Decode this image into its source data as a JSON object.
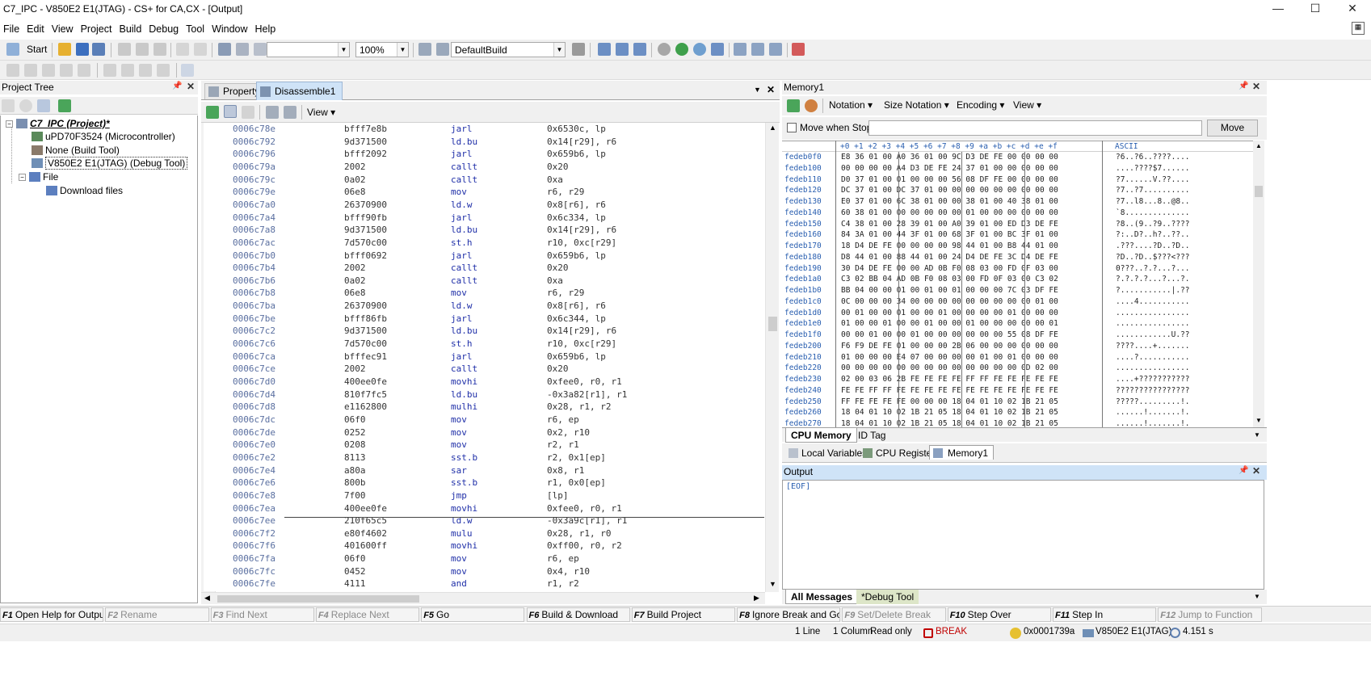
{
  "window": {
    "title": "C7_IPC - V850E2 E1(JTAG) - CS+ for CA,CX - [Output]",
    "minimize": "—",
    "maximize": "☐",
    "close": "✕"
  },
  "menu": [
    "File",
    "Edit",
    "View",
    "Project",
    "Build",
    "Debug",
    "Tool",
    "Window",
    "Help"
  ],
  "toolbar": {
    "start_label": "Start",
    "zoom": "100%",
    "build_config": "DefaultBuild",
    "search_value": ""
  },
  "project_tree": {
    "title": "Project Tree",
    "items": [
      {
        "label": "C7_IPC (Project)*",
        "level": 0
      },
      {
        "label": "uPD70F3524 (Microcontroller)",
        "level": 1
      },
      {
        "label": "None (Build Tool)",
        "level": 1
      },
      {
        "label": "V850E2 E1(JTAG) (Debug Tool)",
        "level": 1
      },
      {
        "label": "File",
        "level": 1
      },
      {
        "label": "Download files",
        "level": 2
      }
    ]
  },
  "center": {
    "tabs": [
      "Property",
      "Disassemble1"
    ],
    "active_tab": "Disassemble1",
    "view_label": "View ▾"
  },
  "disassembly": [
    [
      "0006c78e",
      "bfff7e8b",
      "jarl",
      "0x6530c, lp"
    ],
    [
      "0006c792",
      "9d371500",
      "ld.bu",
      "0x14[r29], r6"
    ],
    [
      "0006c796",
      "bfff2092",
      "jarl",
      "0x659b6, lp"
    ],
    [
      "0006c79a",
      "2002",
      "callt",
      "0x20"
    ],
    [
      "0006c79c",
      "0a02",
      "callt",
      "0xa"
    ],
    [
      "0006c79e",
      "06e8",
      "mov",
      "r6, r29"
    ],
    [
      "0006c7a0",
      "26370900",
      "ld.w",
      "0x8[r6], r6"
    ],
    [
      "0006c7a4",
      "bfff90fb",
      "jarl",
      "0x6c334, lp"
    ],
    [
      "0006c7a8",
      "9d371500",
      "ld.bu",
      "0x14[r29], r6"
    ],
    [
      "0006c7ac",
      "7d570c00",
      "st.h",
      "r10, 0xc[r29]"
    ],
    [
      "0006c7b0",
      "bfff0692",
      "jarl",
      "0x659b6, lp"
    ],
    [
      "0006c7b4",
      "2002",
      "callt",
      "0x20"
    ],
    [
      "0006c7b6",
      "0a02",
      "callt",
      "0xa"
    ],
    [
      "0006c7b8",
      "06e8",
      "mov",
      "r6, r29"
    ],
    [
      "0006c7ba",
      "26370900",
      "ld.w",
      "0x8[r6], r6"
    ],
    [
      "0006c7be",
      "bfff86fb",
      "jarl",
      "0x6c344, lp"
    ],
    [
      "0006c7c2",
      "9d371500",
      "ld.bu",
      "0x14[r29], r6"
    ],
    [
      "0006c7c6",
      "7d570c00",
      "st.h",
      "r10, 0xc[r29]"
    ],
    [
      "0006c7ca",
      "bfffec91",
      "jarl",
      "0x659b6, lp"
    ],
    [
      "0006c7ce",
      "2002",
      "callt",
      "0x20"
    ],
    [
      "0006c7d0",
      "400ee0fe",
      "movhi",
      "0xfee0, r0, r1"
    ],
    [
      "0006c7d4",
      "810f7fc5",
      "ld.bu",
      "-0x3a82[r1], r1"
    ],
    [
      "0006c7d8",
      "e1162800",
      "mulhi",
      "0x28, r1, r2"
    ],
    [
      "0006c7dc",
      "06f0",
      "mov",
      "r6, ep"
    ],
    [
      "0006c7de",
      "0252",
      "mov",
      "0x2, r10"
    ],
    [
      "0006c7e0",
      "0208",
      "mov",
      "r2, r1"
    ],
    [
      "0006c7e2",
      "8113",
      "sst.b",
      "r2, 0x1[ep]"
    ],
    [
      "0006c7e4",
      "a80a",
      "sar",
      "0x8, r1"
    ],
    [
      "0006c7e6",
      "800b",
      "sst.b",
      "r1, 0x0[ep]"
    ],
    [
      "0006c7e8",
      "7f00",
      "jmp",
      "[lp]"
    ],
    [
      "0006c7ea",
      "400ee0fe",
      "movhi",
      "0xfee0, r0, r1"
    ],
    [
      "0006c7ee",
      "210f65c5",
      "ld.w",
      "-0x3a9c[r1], r1"
    ],
    [
      "0006c7f2",
      "e80f4602",
      "mulu",
      "0x28, r1, r0"
    ],
    [
      "0006c7f6",
      "401600ff",
      "movhi",
      "0xff00, r0, r2"
    ],
    [
      "0006c7fa",
      "06f0",
      "mov",
      "r6, ep"
    ],
    [
      "0006c7fc",
      "0452",
      "mov",
      "0x4, r10"
    ],
    [
      "0006c7fe",
      "4111",
      "and",
      "r1, r2"
    ]
  ],
  "memory": {
    "title": "Memory1",
    "toolbar": {
      "notation": "Notation ▾",
      "size_notation": "Size Notation ▾",
      "encoding": "Encoding ▾",
      "view": "View ▾"
    },
    "move_when_stop": "Move when Stop",
    "move_button": "Move",
    "address_input": "",
    "header": "+0 +1 +2 +3 +4 +5 +6 +7 +8 +9 +a +b +c +d +e +f",
    "ascii_header": "ASCII",
    "rows": [
      [
        "fedeb0f0",
        "E8 36 01 00 A0 36 01 00 9C D3 DE FE 00 00 00 00",
        "?6..?6..????...."
      ],
      [
        "fedeb100",
        "00 00 00 00 A4 D3 DE FE 24 37 01 00 00 00 00 00",
        "....????$7......"
      ],
      [
        "fedeb110",
        "D0 37 01 00 01 00 00 00 56 08 DF FE 00 00 00 00",
        "?7......V.??...."
      ],
      [
        "fedeb120",
        "DC 37 01 00 DC 37 01 00 00 00 00 00 00 00 00 00",
        "?7..?7.........."
      ],
      [
        "fedeb130",
        "E0 37 01 00 6C 38 01 00 00 38 01 00 40 38 01 00",
        "?7..l8...8..@8.."
      ],
      [
        "fedeb140",
        "60 38 01 00 00 00 00 00 00 01 00 00 00 00 00 00",
        "`8.............."
      ],
      [
        "fedeb150",
        "C4 38 01 00 28 39 01 00 A0 39 01 00 ED D3 DE FE",
        "?8..(9..?9..????"
      ],
      [
        "fedeb160",
        "84 3A 01 00 44 3F 01 00 68 3F 01 00 BC 3F 01 00",
        "?:..D?..h?..??.."
      ],
      [
        "fedeb170",
        "18 D4 DE FE 00 00 00 00 98 44 01 00 B8 44 01 00",
        ".???....?D..?D.."
      ],
      [
        "fedeb180",
        "D8 44 01 00 88 44 01 00 24 D4 DE FE 3C D4 DE FE",
        "?D..?D..$???<???"
      ],
      [
        "fedeb190",
        "30 D4 DE FE 00 00 AD 0B F0 08 03 00 FD 0F 03 00",
        "0???..?.?...?..."
      ],
      [
        "fedeb1a0",
        "C3 02 BB 04 AD 0B F0 08 03 00 FD 0F 03 00 C3 02",
        "?.?.?.?...?...?."
      ],
      [
        "fedeb1b0",
        "BB 04 00 00 01 00 01 00 01 00 00 00 7C 03 DF FE",
        "?...........|.??"
      ],
      [
        "fedeb1c0",
        "0C 00 00 00 34 00 00 00 00 00 00 00 00 00 01 00",
        "....4..........."
      ],
      [
        "fedeb1d0",
        "00 01 00 00 01 00 00 01 00 00 00 00 01 00 00 00",
        "................"
      ],
      [
        "fedeb1e0",
        "01 00 00 01 00 00 01 00 00 01 00 00 00 00 00 01",
        "................"
      ],
      [
        "fedeb1f0",
        "00 00 01 00 00 01 00 00 00 00 00 00 55 08 DF FE",
        "............U.??"
      ],
      [
        "fedeb200",
        "F6 F9 DE FE 01 00 00 00 2B 06 00 00 00 00 00 00",
        "????....+......."
      ],
      [
        "fedeb210",
        "01 00 00 00 E4 07 00 00 00 00 01 00 01 00 00 00",
        "....?..........."
      ],
      [
        "fedeb220",
        "00 00 00 00 00 00 00 00 00 00 00 00 00 0D 02 00",
        "................"
      ],
      [
        "fedeb230",
        "02 00 03 06 2B FE FE FE FE FF FF FE FE FE FE FE",
        "....+???????????"
      ],
      [
        "fedeb240",
        "FE FE FF FF FE FE FE FE FE FE FE FE FE FE FE FE",
        "????????????????"
      ],
      [
        "fedeb250",
        "FF FE FE FE FE 00 00 00 18 04 01 10 02 1B 21 05",
        "?????.........!."
      ],
      [
        "fedeb260",
        "18 04 01 10 02 1B 21 05 18 04 01 10 02 1B 21 05",
        "......!.......!."
      ],
      [
        "fedeb270",
        "18 04 01 10 02 1B 21 05 18 04 01 10 02 1B 21 05",
        "......!.......!."
      ]
    ],
    "tabs": [
      "CPU Memory",
      "ID Tag"
    ]
  },
  "debug_tabs": [
    "Local Variables",
    "CPU Register",
    "Memory1"
  ],
  "output": {
    "title": "Output",
    "content": "[EOF]",
    "tabs": [
      "All Messages",
      "*Debug Tool"
    ]
  },
  "function_keys": [
    {
      "key": "F1",
      "label": "Open Help for Output...",
      "enabled": true
    },
    {
      "key": "F2",
      "label": "Rename",
      "enabled": false
    },
    {
      "key": "F3",
      "label": "Find Next",
      "enabled": false
    },
    {
      "key": "F4",
      "label": "Replace Next",
      "enabled": false
    },
    {
      "key": "F5",
      "label": "Go",
      "enabled": true
    },
    {
      "key": "F6",
      "label": "Build & Download",
      "enabled": true
    },
    {
      "key": "F7",
      "label": "Build Project",
      "enabled": true
    },
    {
      "key": "F8",
      "label": "Ignore Break and Go",
      "enabled": true
    },
    {
      "key": "F9",
      "label": "Set/Delete Break",
      "enabled": false
    },
    {
      "key": "F10",
      "label": "Step Over",
      "enabled": true
    },
    {
      "key": "F11",
      "label": "Step In",
      "enabled": true
    },
    {
      "key": "F12",
      "label": "Jump to Function",
      "enabled": false
    }
  ],
  "status": {
    "line": "1 Line",
    "column": "1 Column",
    "mode": "Read only",
    "state": "BREAK",
    "pc": "0x0001739a",
    "tool": "V850E2 E1(JTAG)",
    "time": "4.151 s"
  },
  "colors": {
    "accent": "#cfe3f7",
    "address": "#5a6fa0",
    "mnemonic": "#1f2fa8",
    "mem_address": "#2a5fb0",
    "break": "#c00000"
  }
}
